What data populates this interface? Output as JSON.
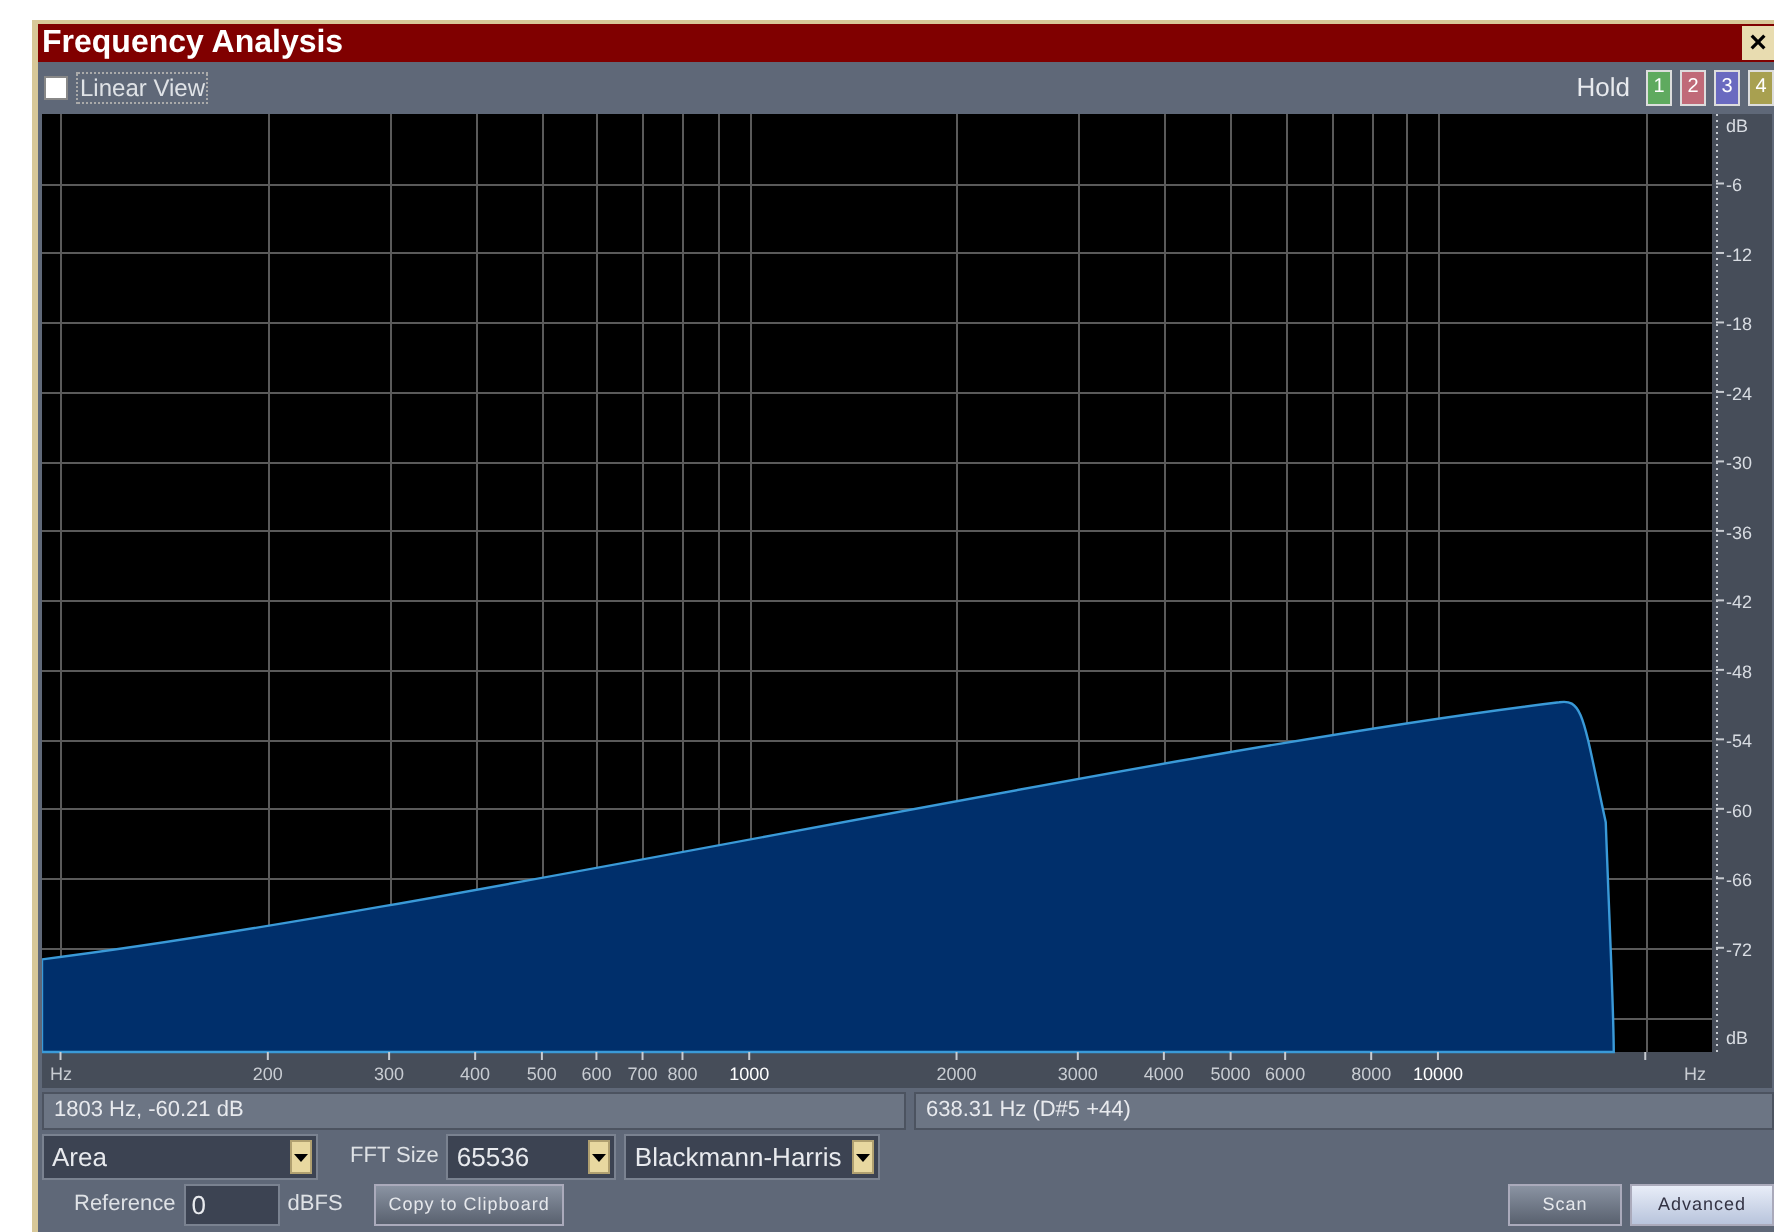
{
  "window": {
    "title": "Frequency Analysis",
    "close_label": "×"
  },
  "toolbar": {
    "linear_view": {
      "label": "Linear View",
      "checked": false
    },
    "hold_label": "Hold",
    "hold_buttons": [
      {
        "label": "1",
        "color": "#5faa5f"
      },
      {
        "label": "2",
        "color": "#c06a78"
      },
      {
        "label": "3",
        "color": "#6a6ac0"
      },
      {
        "label": "4",
        "color": "#a8a050"
      }
    ]
  },
  "chart": {
    "y_axis_labels": [
      "dB",
      "-6",
      "-12",
      "-18",
      "-24",
      "-30",
      "-36",
      "-42",
      "-48",
      "-54",
      "-60",
      "-66",
      "-72",
      "dB"
    ],
    "x_axis_labels": [
      "Hz",
      "200",
      "300",
      "400",
      "500",
      "600",
      "700",
      "800",
      "1000",
      "2000",
      "3000",
      "4000",
      "5000",
      "6000",
      "8000",
      "10000",
      "Hz"
    ]
  },
  "status_bar": [
    "1803 Hz, -60.21 dB",
    "638.31 Hz (D#5 +44)"
  ],
  "controls": {
    "display_mode": "Area",
    "fft_size_label": "FFT Size",
    "fft_size": "65536",
    "window_function": "Blackmann-Harris",
    "reference_label": "Reference",
    "reference": "0",
    "reference_unit": "dBFS",
    "copy_button": "Copy to Clipboard",
    "scan_button": "Scan",
    "advanced_button": "Advanced"
  }
}
